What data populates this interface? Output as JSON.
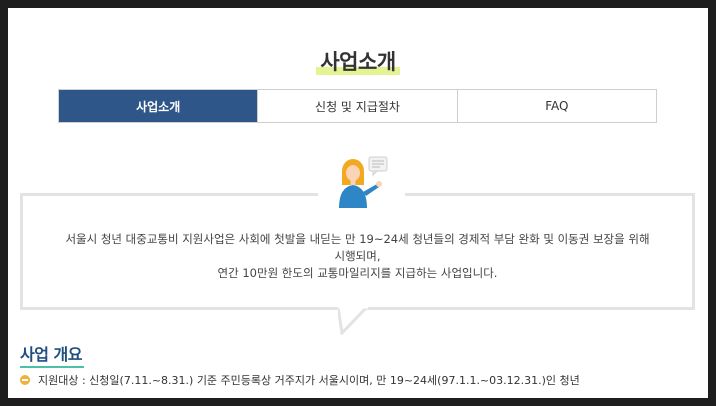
{
  "page": {
    "title": "사업소개"
  },
  "tabs": [
    {
      "label": "사업소개",
      "active": true
    },
    {
      "label": "신청 및 지급절차",
      "active": false
    },
    {
      "label": "FAQ",
      "active": false
    }
  ],
  "intro": {
    "line1": "서울시 청년 대중교통비 지원사업은 사회에 첫발을 내딛는 만 19~24세 청년들의 경제적 부담 완화 및 이동권 보장을 위해",
    "line2": "시행되며,",
    "line3": "연간 10만원 한도의 교통마일리지를 지급하는 사업입니다."
  },
  "overview": {
    "title": "사업 개요",
    "items": [
      {
        "text": "지원대상 : 신청일(7.11.~8.31.) 기준 주민등록상 거주지가 서울시이며, 만 19~24세(97.1.1.~03.12.31.)인 청년"
      }
    ]
  },
  "colors": {
    "tab_active": "#2e5688",
    "title_highlight": "#e4f493",
    "section_underline": "#4cc0a6",
    "bullet": "#f0b03a"
  }
}
